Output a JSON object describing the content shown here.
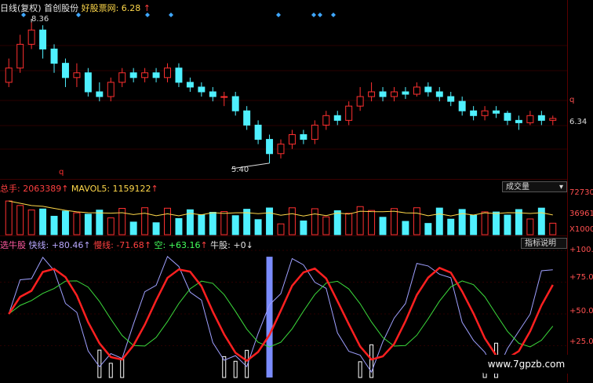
{
  "price_panel": {
    "title_parts": [
      "日线(复权)",
      "首创股份",
      "好股票网: 6.28"
    ],
    "high_label": "8.36",
    "low_label": "5.40",
    "last_label": "6.34",
    "period_marker": "q",
    "axis_label": "q"
  },
  "volume_panel": {
    "legend": [
      "总手: 2063389",
      "MAVOL5: 1159122"
    ],
    "dropdown_label": "成交量",
    "axis_labels": [
      "72730",
      "36961",
      "X1000"
    ]
  },
  "indicator_panel": {
    "legend": [
      "选牛股",
      "快线: +80.46",
      "慢线: -71.68",
      "空: +63.16",
      "牛股: +0"
    ],
    "button_label": "指标说明",
    "axis_labels": [
      "+100.0",
      "+75.00",
      "+50.00",
      "+25.00"
    ]
  },
  "watermark": "www.7gpzb.com",
  "colors": {
    "up": "#ff3030",
    "down": "#4ff0ff",
    "fast": "#9fa0ff",
    "slow": "#ff2020",
    "mid": "#3cdc3c"
  },
  "chart_data": {
    "type": "candlestick",
    "price_y_range": [
      5.2,
      8.6
    ],
    "candles": [
      {
        "o": 7.1,
        "c": 7.4,
        "h": 7.6,
        "l": 7.0
      },
      {
        "o": 7.4,
        "c": 7.9,
        "h": 8.1,
        "l": 7.3
      },
      {
        "o": 7.9,
        "c": 8.2,
        "h": 8.36,
        "l": 7.8
      },
      {
        "o": 8.2,
        "c": 7.8,
        "h": 8.3,
        "l": 7.6
      },
      {
        "o": 7.8,
        "c": 7.5,
        "h": 7.9,
        "l": 7.3
      },
      {
        "o": 7.5,
        "c": 7.2,
        "h": 7.6,
        "l": 7.0
      },
      {
        "o": 7.2,
        "c": 7.3,
        "h": 7.5,
        "l": 7.0
      },
      {
        "o": 7.3,
        "c": 6.9,
        "h": 7.4,
        "l": 6.8
      },
      {
        "o": 6.9,
        "c": 6.8,
        "h": 7.1,
        "l": 6.7
      },
      {
        "o": 6.8,
        "c": 7.1,
        "h": 7.2,
        "l": 6.7
      },
      {
        "o": 7.1,
        "c": 7.3,
        "h": 7.4,
        "l": 7.0
      },
      {
        "o": 7.3,
        "c": 7.2,
        "h": 7.4,
        "l": 7.1
      },
      {
        "o": 7.2,
        "c": 7.3,
        "h": 7.4,
        "l": 7.1
      },
      {
        "o": 7.3,
        "c": 7.2,
        "h": 7.4,
        "l": 7.1
      },
      {
        "o": 7.2,
        "c": 7.4,
        "h": 7.5,
        "l": 7.1
      },
      {
        "o": 7.4,
        "c": 7.1,
        "h": 7.5,
        "l": 7.0
      },
      {
        "o": 7.1,
        "c": 7.0,
        "h": 7.2,
        "l": 6.9
      },
      {
        "o": 7.0,
        "c": 6.9,
        "h": 7.1,
        "l": 6.8
      },
      {
        "o": 6.9,
        "c": 6.8,
        "h": 7.0,
        "l": 6.7
      },
      {
        "o": 6.8,
        "c": 6.8,
        "h": 6.9,
        "l": 6.6
      },
      {
        "o": 6.8,
        "c": 6.5,
        "h": 6.9,
        "l": 6.4
      },
      {
        "o": 6.5,
        "c": 6.2,
        "h": 6.6,
        "l": 6.1
      },
      {
        "o": 6.2,
        "c": 5.9,
        "h": 6.3,
        "l": 5.8
      },
      {
        "o": 5.9,
        "c": 5.6,
        "h": 6.0,
        "l": 5.4
      },
      {
        "o": 5.6,
        "c": 5.8,
        "h": 5.9,
        "l": 5.5
      },
      {
        "o": 5.8,
        "c": 6.0,
        "h": 6.1,
        "l": 5.7
      },
      {
        "o": 6.0,
        "c": 5.9,
        "h": 6.1,
        "l": 5.8
      },
      {
        "o": 5.9,
        "c": 6.2,
        "h": 6.3,
        "l": 5.8
      },
      {
        "o": 6.2,
        "c": 6.4,
        "h": 6.5,
        "l": 6.1
      },
      {
        "o": 6.4,
        "c": 6.3,
        "h": 6.5,
        "l": 6.2
      },
      {
        "o": 6.3,
        "c": 6.6,
        "h": 6.7,
        "l": 6.2
      },
      {
        "o": 6.6,
        "c": 6.8,
        "h": 7.0,
        "l": 6.5
      },
      {
        "o": 6.8,
        "c": 6.9,
        "h": 7.1,
        "l": 6.7
      },
      {
        "o": 6.9,
        "c": 6.8,
        "h": 7.0,
        "l": 6.7
      },
      {
        "o": 6.8,
        "c": 6.9,
        "h": 7.0,
        "l": 6.7
      },
      {
        "o": 6.9,
        "c": 6.85,
        "h": 7.0,
        "l": 6.75
      },
      {
        "o": 6.85,
        "c": 7.0,
        "h": 7.1,
        "l": 6.8
      },
      {
        "o": 7.0,
        "c": 6.9,
        "h": 7.1,
        "l": 6.8
      },
      {
        "o": 6.9,
        "c": 6.8,
        "h": 7.0,
        "l": 6.7
      },
      {
        "o": 6.8,
        "c": 6.7,
        "h": 6.9,
        "l": 6.6
      },
      {
        "o": 6.7,
        "c": 6.5,
        "h": 6.8,
        "l": 6.4
      },
      {
        "o": 6.5,
        "c": 6.4,
        "h": 6.6,
        "l": 6.3
      },
      {
        "o": 6.4,
        "c": 6.5,
        "h": 6.6,
        "l": 6.3
      },
      {
        "o": 6.5,
        "c": 6.45,
        "h": 6.6,
        "l": 6.35
      },
      {
        "o": 6.45,
        "c": 6.3,
        "h": 6.5,
        "l": 6.2
      },
      {
        "o": 6.3,
        "c": 6.25,
        "h": 6.4,
        "l": 6.1
      },
      {
        "o": 6.25,
        "c": 6.4,
        "h": 6.5,
        "l": 6.2
      },
      {
        "o": 6.4,
        "c": 6.3,
        "h": 6.5,
        "l": 6.2
      },
      {
        "o": 6.3,
        "c": 6.34,
        "h": 6.4,
        "l": 6.2
      }
    ],
    "volume_y_range": [
      0,
      72730
    ],
    "indicator_y_range": [
      0,
      100
    ]
  }
}
